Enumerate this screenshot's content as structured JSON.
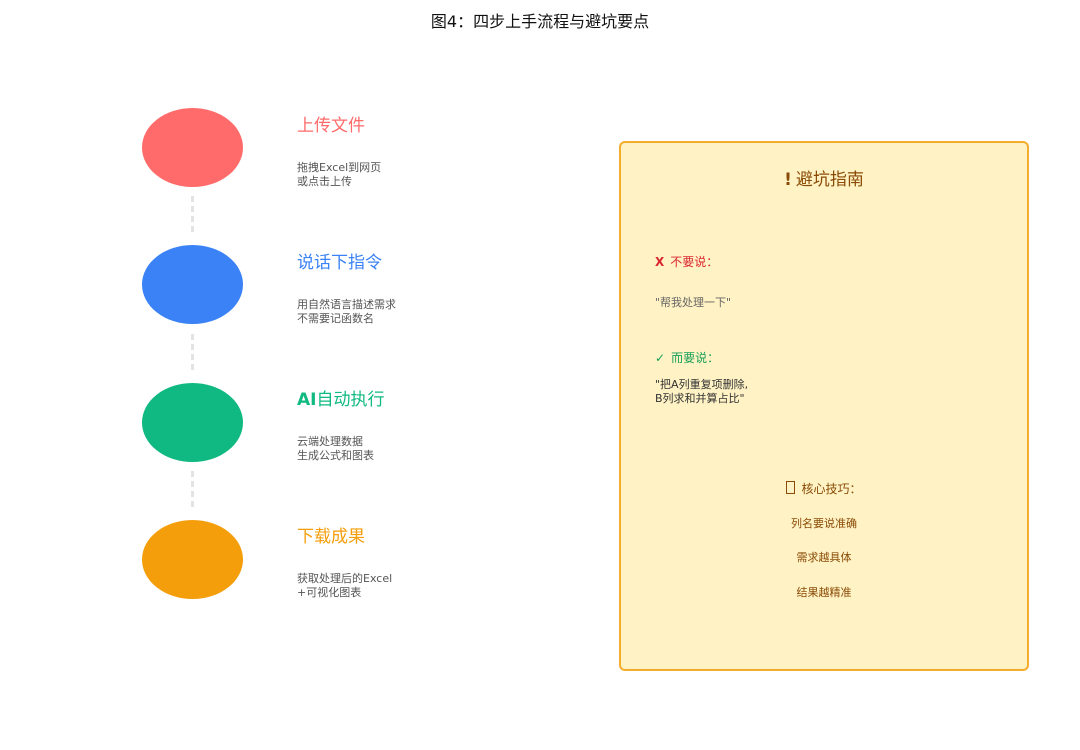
{
  "title": "图4：四步上手流程与避坑要点",
  "steps": [
    {
      "title": "上传文件",
      "desc_line1": "拖拽Excel到网页",
      "desc_line2": "或点击上传",
      "color": "#ff6b6b"
    },
    {
      "title": "说话下指令",
      "desc_line1": "用自然语言描述需求",
      "desc_line2": "不需要记函数名",
      "color": "#3b82f6"
    },
    {
      "title_prefix": "AI",
      "title": "自动执行",
      "desc_line1": "云端处理数据",
      "desc_line2": "生成公式和图表",
      "color": "#10b981"
    },
    {
      "title": "下载成果",
      "desc_line1": "获取处理后的Excel",
      "desc_line2": "+可视化图表",
      "color": "#f59e0b"
    }
  ],
  "guide": {
    "title_icon": "!",
    "title": "避坑指南",
    "dont": {
      "icon": "X",
      "label": "不要说：",
      "example": "\"帮我处理一下\""
    },
    "do": {
      "icon": "✓",
      "label": "而要说：",
      "example_line1": "\"把A列重复项删除,",
      "example_line2": "B列求和并算占比\""
    },
    "tips": {
      "label": "核心技巧：",
      "items": [
        "列名要说准确",
        "需求越具体",
        "结果越精准"
      ]
    }
  },
  "colors": {
    "guide_bg": "#fff2c4",
    "guide_border": "#f6ad2c",
    "guide_text": "#8a4b06",
    "dont": "#d9262e",
    "do": "#18a05a"
  }
}
